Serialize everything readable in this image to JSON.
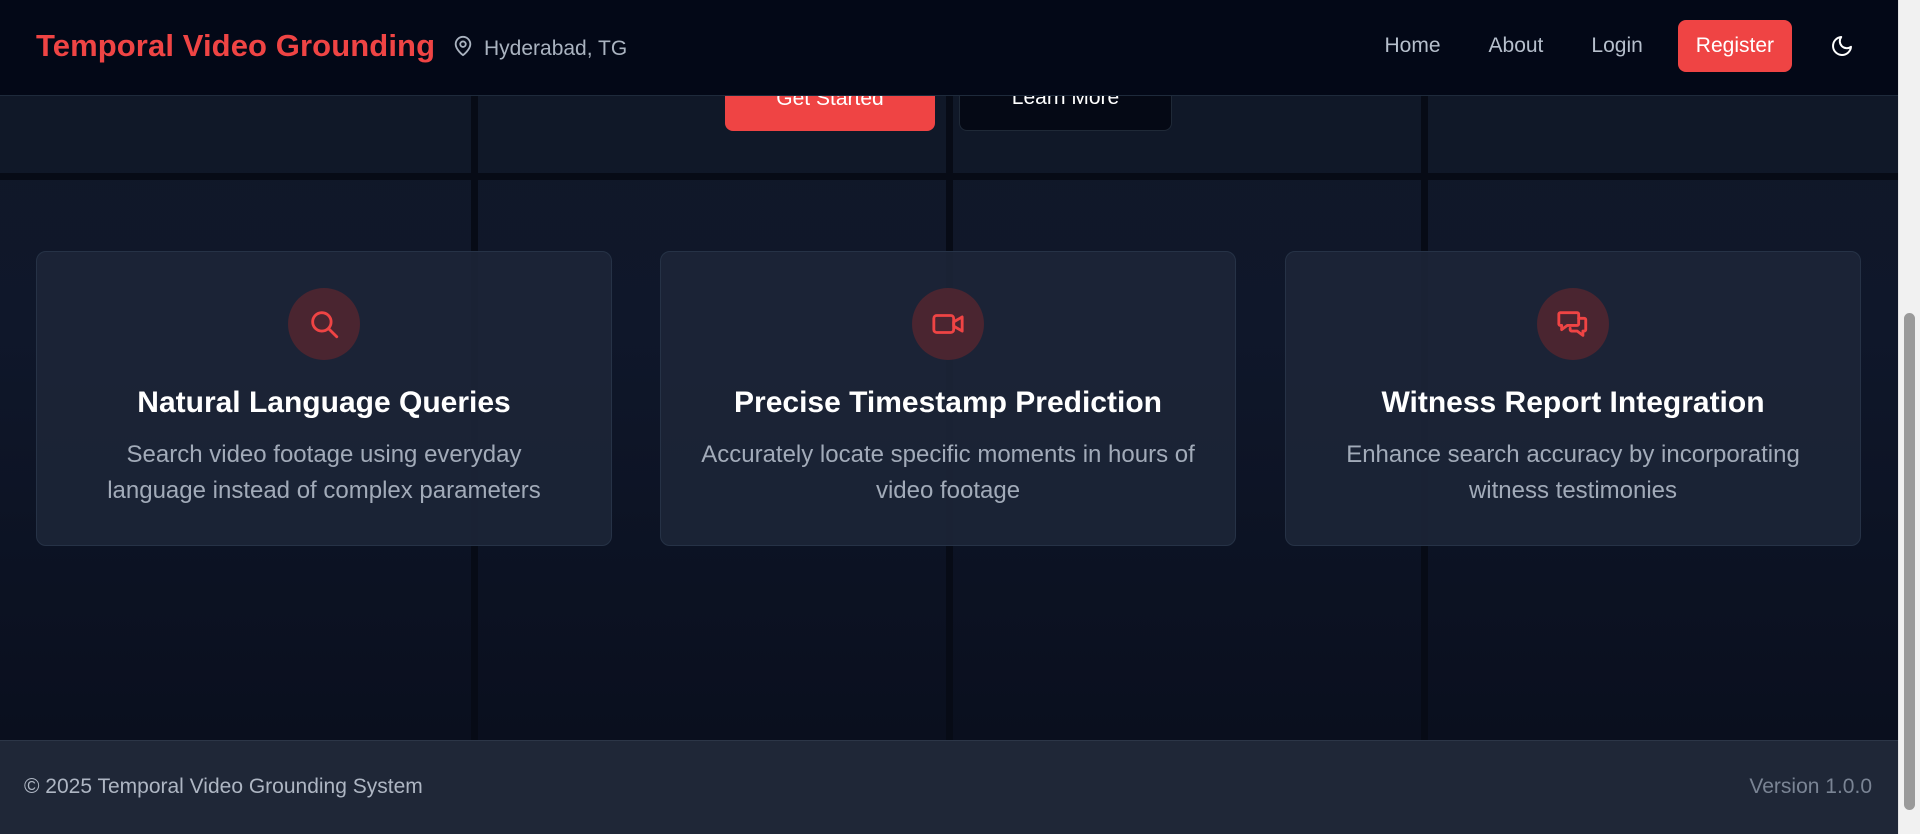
{
  "header": {
    "brand": "Temporal Video Grounding",
    "location": {
      "icon": "map-pin-icon",
      "text": "Hyderabad, TG"
    },
    "nav": {
      "home": "Home",
      "about": "About",
      "login": "Login",
      "register": "Register"
    },
    "theme_toggle_icon": "moon-icon"
  },
  "hero": {
    "primary_button": "Get Started",
    "secondary_button": "Learn More"
  },
  "features": [
    {
      "icon": "search-icon",
      "title": "Natural Language Queries",
      "description": "Search video footage using everyday language instead of complex parameters"
    },
    {
      "icon": "video-camera-icon",
      "title": "Precise Timestamp Prediction",
      "description": "Accurately locate specific moments in hours of video footage"
    },
    {
      "icon": "chat-bubbles-icon",
      "title": "Witness Report Integration",
      "description": "Enhance search accuracy by incorporating witness testimonies"
    }
  ],
  "footer": {
    "copyright": "© 2025 Temporal Video Grounding System",
    "version": "Version 1.0.0"
  },
  "colors": {
    "accent": "#ef4444",
    "background": "#0b1120",
    "card": "#1c2537",
    "footer": "#1f2737"
  }
}
